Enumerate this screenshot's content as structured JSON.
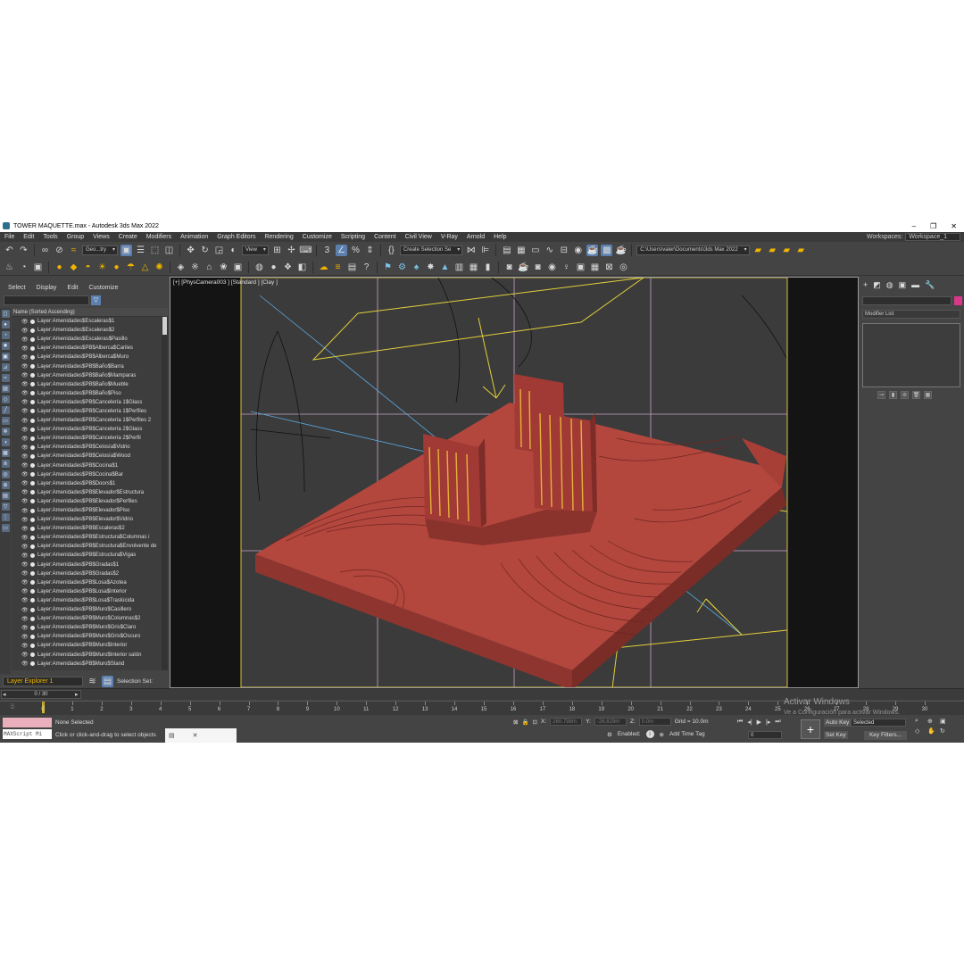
{
  "window": {
    "title": "TOWER MAQUETTE.max - Autodesk 3ds Max 2022",
    "controls": [
      "–",
      "❐",
      "✕"
    ]
  },
  "menu": {
    "items": [
      "File",
      "Edit",
      "Tools",
      "Group",
      "Views",
      "Create",
      "Modifiers",
      "Animation",
      "Graph Editors",
      "Rendering",
      "Customize",
      "Scripting",
      "Content",
      "Civil View",
      "V-Ray",
      "Arnold",
      "Help"
    ],
    "workspaces_label": "Workspaces:",
    "workspace_value": "Workspace_1"
  },
  "toolbar": {
    "selection_filter": "Geo...try",
    "reference_coord": "View",
    "named_selection": "Create Selection Se",
    "project_path": "C:\\Users\\valer\\Documents\\3ds Max 2022"
  },
  "scene_explorer": {
    "tabs": [
      "Select",
      "Display",
      "Edit",
      "Customize"
    ],
    "column_header": "Name (Sorted Ascending)",
    "layers": [
      "Layer:Amenidades$Escaleras$1",
      "Layer:Amenidades$Escaleras$2",
      "Layer:Amenidades$Escaleras$Pasillo",
      "Layer:Amenidades$PB$Alberca$Cariles",
      "Layer:Amenidades$PB$Alberca$Muro",
      "Layer:Amenidades$PB$Baño$Barra",
      "Layer:Amenidades$PB$Baño$Mamparas",
      "Layer:Amenidades$PB$Baño$Mueble",
      "Layer:Amenidades$PB$Baño$Piso",
      "Layer:Amenidades$PB$Cancelería 1$Glass",
      "Layer:Amenidades$PB$Cancelería 1$Perfiles",
      "Layer:Amenidades$PB$Cancelería 1$Perfiles 2",
      "Layer:Amenidades$PB$Cancelería 2$Glass",
      "Layer:Amenidades$PB$Cancelería 2$Perfil",
      "Layer:Amenidades$PB$Celosía$Vidrio",
      "Layer:Amenidades$PB$Celosía$Wood",
      "Layer:Amenidades$PB$Cocina$1",
      "Layer:Amenidades$PB$Cocina$Bar",
      "Layer:Amenidades$PB$Doors$1",
      "Layer:Amenidades$PB$Elevador$Estructura",
      "Layer:Amenidades$PB$Elevador$Perfiles",
      "Layer:Amenidades$PB$Elevador$Piso",
      "Layer:Amenidades$PB$Elevador$Vidrio",
      "Layer:Amenidades$PB$Escaleras$2",
      "Layer:Amenidades$PB$Estructura$Columnas i",
      "Layer:Amenidades$PB$Estructura$Envolvente de",
      "Layer:Amenidades$PB$Estructura$Vigas",
      "Layer:Amenidades$PB$Gradas$1",
      "Layer:Amenidades$PB$Gradas$2",
      "Layer:Amenidades$PB$Losa$Azotea",
      "Layer:Amenidades$PB$Losa$Interior",
      "Layer:Amenidades$PB$Losa$Traslúcida",
      "Layer:Amenidades$PB$Muro$Casillero",
      "Layer:Amenidades$PB$Muro$Columnas$2",
      "Layer:Amenidades$PB$Muro$Gris$Claro",
      "Layer:Amenidades$PB$Muro$Gris$Oscuro",
      "Layer:Amenidades$PB$Muro$Interior",
      "Layer:Amenidades$PB$Muro$Interior salón",
      "Layer:Amenidades$PB$Muro$Stand"
    ],
    "explorer_name": "Layer Explorer 1",
    "selection_set_label": "Selection Set:"
  },
  "viewport": {
    "label": "[+] [PhysCamera003 ] [Standard ] [Clay ]"
  },
  "command_panel": {
    "tabs": [
      "+",
      "◩",
      "◍",
      "▣",
      "▬",
      "🔧"
    ],
    "modifier_list": "Modifier List",
    "accent_color": "#d9378a"
  },
  "timeline": {
    "slider": "0 / 30",
    "ticks": [
      "0",
      "1",
      "2",
      "3",
      "4",
      "5",
      "6",
      "7",
      "8",
      "9",
      "10",
      "11",
      "12",
      "13",
      "14",
      "15",
      "16",
      "17",
      "18",
      "19",
      "20",
      "21",
      "22",
      "23",
      "24",
      "25",
      "26",
      "27",
      "28",
      "29",
      "30"
    ],
    "frame_fraction": 0.0
  },
  "status": {
    "maxscript": "MAXScript Mi",
    "line1": "None Selected",
    "line2": "Click or click-and-drag to select objects",
    "x_label": "X:",
    "x_value": "260.798m",
    "y_label": "Y:",
    "y_value": "-26.829m",
    "z_label": "Z:",
    "z_value": "0.0m",
    "grid": "Grid = 10.0m",
    "enabled_label": "Enabled:",
    "add_time_tag": "Add Time Tag",
    "auto_key": "Auto Key",
    "selected": "Selected",
    "set_key": "Set Key",
    "key_filters": "Key Filters...",
    "frame": "0"
  },
  "watermark": {
    "line1": "Activar Windows",
    "line2": "Ve a Configuración para activar Windows."
  }
}
